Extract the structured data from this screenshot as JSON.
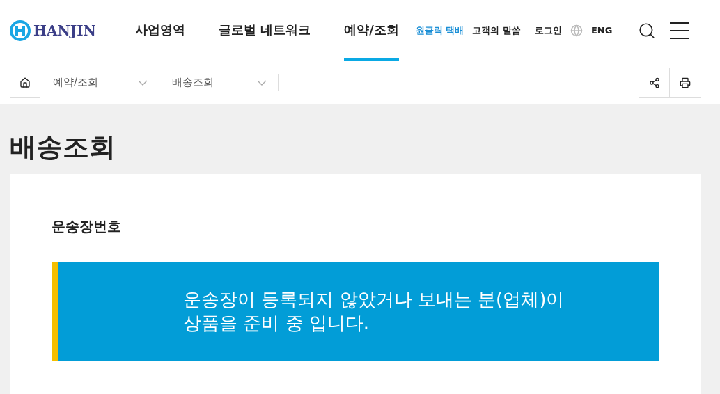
{
  "logo": {
    "text": "HANJIN"
  },
  "nav": [
    {
      "label": "사업영역",
      "selected": false
    },
    {
      "label": "글로벌 네트워크",
      "selected": false
    },
    {
      "label": "예약/조회",
      "selected": true
    }
  ],
  "utility_links": [
    {
      "label": "원클릭 택배",
      "kind": "highlight"
    },
    {
      "label": "고객의 말씀",
      "kind": "plain"
    },
    {
      "label": "로그인",
      "kind": "plain"
    }
  ],
  "language": "ENG",
  "breadcrumb": [
    {
      "label": "예약/조회"
    },
    {
      "label": "배송조회"
    }
  ],
  "page_title": "배송조회",
  "field_label": "운송장번호",
  "notice": [
    "운송장이 등록되지 않았거나 보내는 분(업체)이",
    "상품을 준비 중 입니다."
  ]
}
